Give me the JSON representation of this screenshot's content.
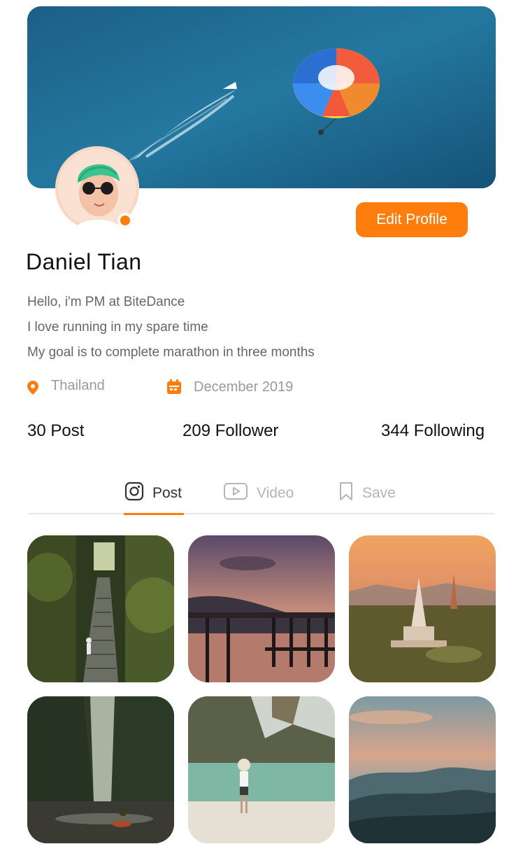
{
  "profile": {
    "name": "Daniel Tian",
    "edit_label": "Edit Profile",
    "bio": [
      "Hello, i'm PM at BiteDance",
      "I love running in my spare time",
      "My goal is to complete marathon in three months"
    ],
    "location": "Thailand",
    "joined": "December 2019",
    "status": "online"
  },
  "stats": {
    "posts": "30 Post",
    "followers": "209 Follower",
    "following": "344 Following"
  },
  "tabs": [
    {
      "label": "Post",
      "icon": "instagram-icon",
      "active": true
    },
    {
      "label": "Video",
      "icon": "play-icon",
      "active": false
    },
    {
      "label": "Save",
      "icon": "bookmark-icon",
      "active": false
    }
  ],
  "colors": {
    "accent": "#ff7d0d",
    "muted_text": "#9a9a9a",
    "body_text": "#666666"
  },
  "posts": [
    {
      "subject": "forest-stairs-photo"
    },
    {
      "subject": "sunset-pier-photo"
    },
    {
      "subject": "temple-pagoda-photo"
    },
    {
      "subject": "river-canyon-photo"
    },
    {
      "subject": "beach-woman-photo"
    },
    {
      "subject": "mountain-sunset-photo"
    }
  ]
}
